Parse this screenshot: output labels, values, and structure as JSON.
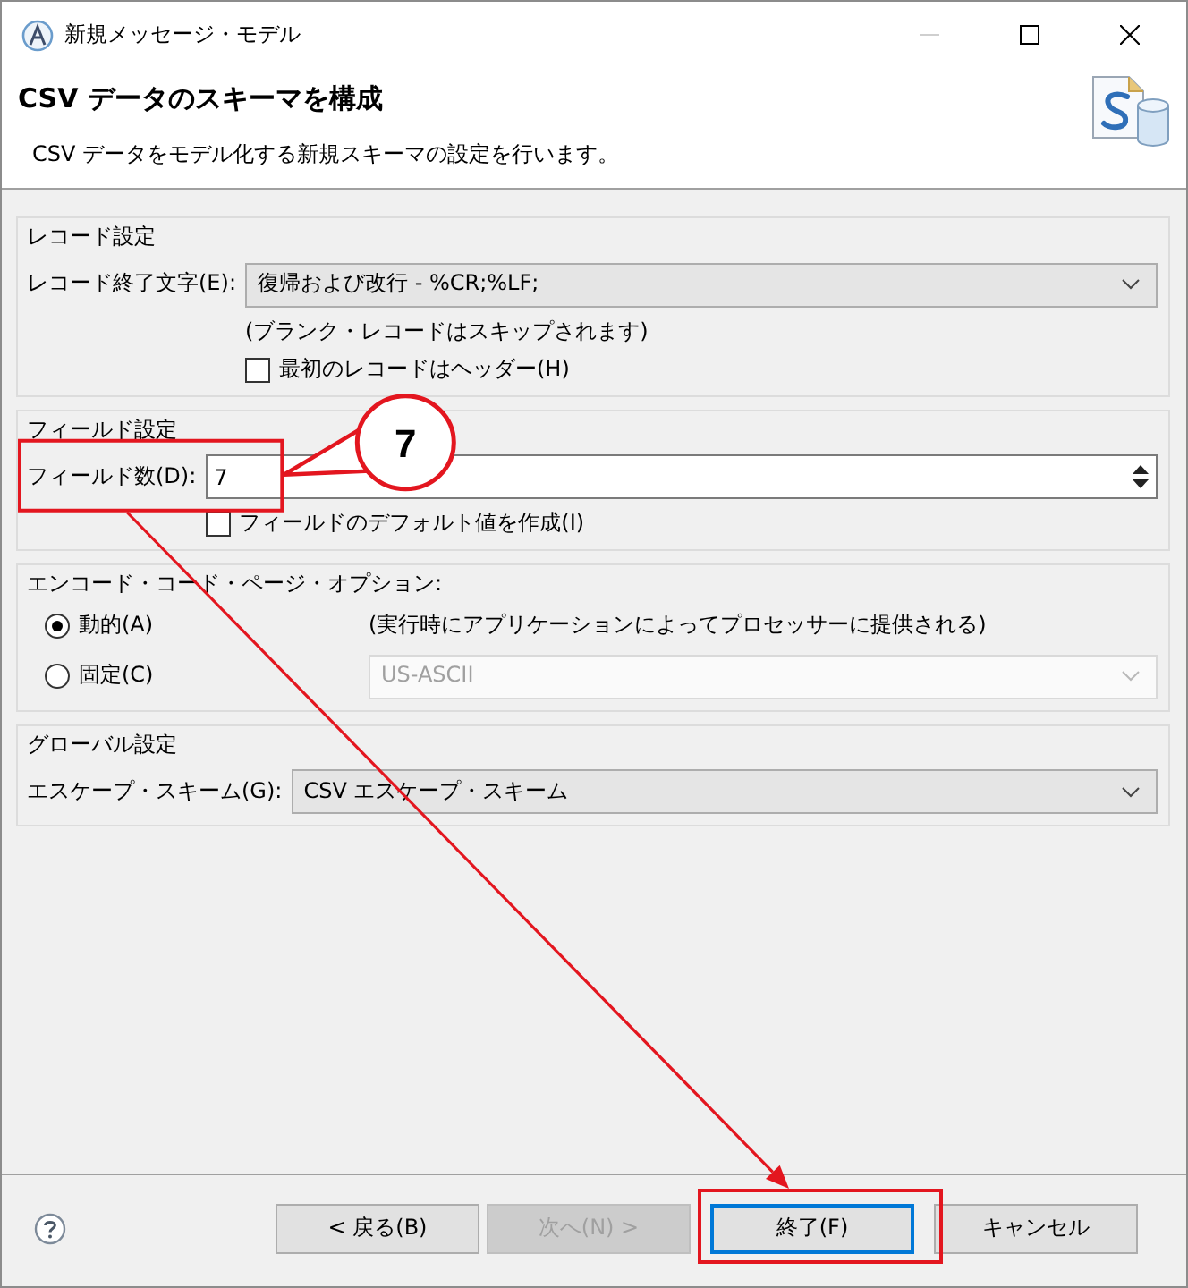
{
  "window": {
    "title": "新規メッセージ・モデル",
    "minimize_disabled": true
  },
  "header": {
    "title": "CSV データのスキーマを構成",
    "description": "CSV データをモデル化する新規スキーマの設定を行います。"
  },
  "groups": [
    {
      "title": "レコード設定",
      "rows": [
        {
          "kind": "combo",
          "label": "レコード終了文字(E):",
          "value": "復帰および改行 - %CR;%LF;",
          "disabled": false
        },
        {
          "kind": "note",
          "text": "(ブランク・レコードはスキップされます)"
        },
        {
          "kind": "checkbox",
          "label": "最初のレコードはヘッダー(H)",
          "checked": false
        }
      ]
    },
    {
      "title": "フィールド設定",
      "rows": [
        {
          "kind": "spinner",
          "label": "フィールド数(D):",
          "value": "7",
          "highlighted": true
        },
        {
          "kind": "checkbox",
          "label": "フィールドのデフォルト値を作成(I)",
          "checked": false
        }
      ]
    },
    {
      "title": "エンコード・コード・ページ・オプション:",
      "rows": [
        {
          "kind": "radio",
          "label": "動的(A)",
          "selected": true,
          "note": "(実行時にアプリケーションによってプロセッサーに提供される)"
        },
        {
          "kind": "radio",
          "label": "固定(C)",
          "selected": false,
          "combo": {
            "value": "US-ASCII",
            "disabled": true
          }
        }
      ]
    },
    {
      "title": "グローバル設定",
      "rows": [
        {
          "kind": "combo",
          "label": "エスケープ・スキーム(G):",
          "value": "CSV エスケープ・スキーム",
          "disabled": false
        }
      ]
    }
  ],
  "buttons": [
    {
      "label": "< 戻る(B)",
      "disabled": false,
      "default": false,
      "highlighted": false
    },
    {
      "label": "次へ(N) >",
      "disabled": true,
      "default": false,
      "highlighted": false
    },
    {
      "label": "終了(F)",
      "disabled": false,
      "default": true,
      "highlighted": true
    },
    {
      "label": "キャンセル",
      "disabled": false,
      "default": false,
      "highlighted": false
    }
  ],
  "annotations": {
    "callout": "7",
    "arrow": true
  }
}
